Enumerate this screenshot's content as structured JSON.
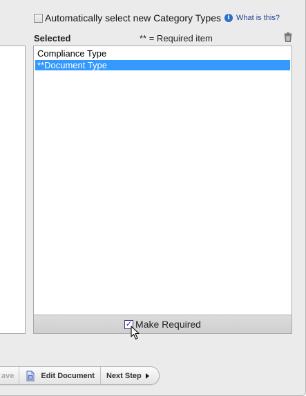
{
  "auto_select": {
    "label": "Automatically select new Category Types",
    "checked": false,
    "help_link": "What is this?",
    "info_icon": "info-icon"
  },
  "selected": {
    "heading": "Selected",
    "required_note": "** = Required item",
    "delete_icon": "trash-icon",
    "items": [
      {
        "label": "Compliance Type",
        "selected": false
      },
      {
        "label": "**Document Type",
        "selected": true
      }
    ],
    "selection_color": "#3399ff"
  },
  "make_required": {
    "label": "Make Required",
    "checked": true
  },
  "toolbar": {
    "save_label": "ave",
    "edit_label": "Edit Document",
    "next_label": "Next Step"
  }
}
